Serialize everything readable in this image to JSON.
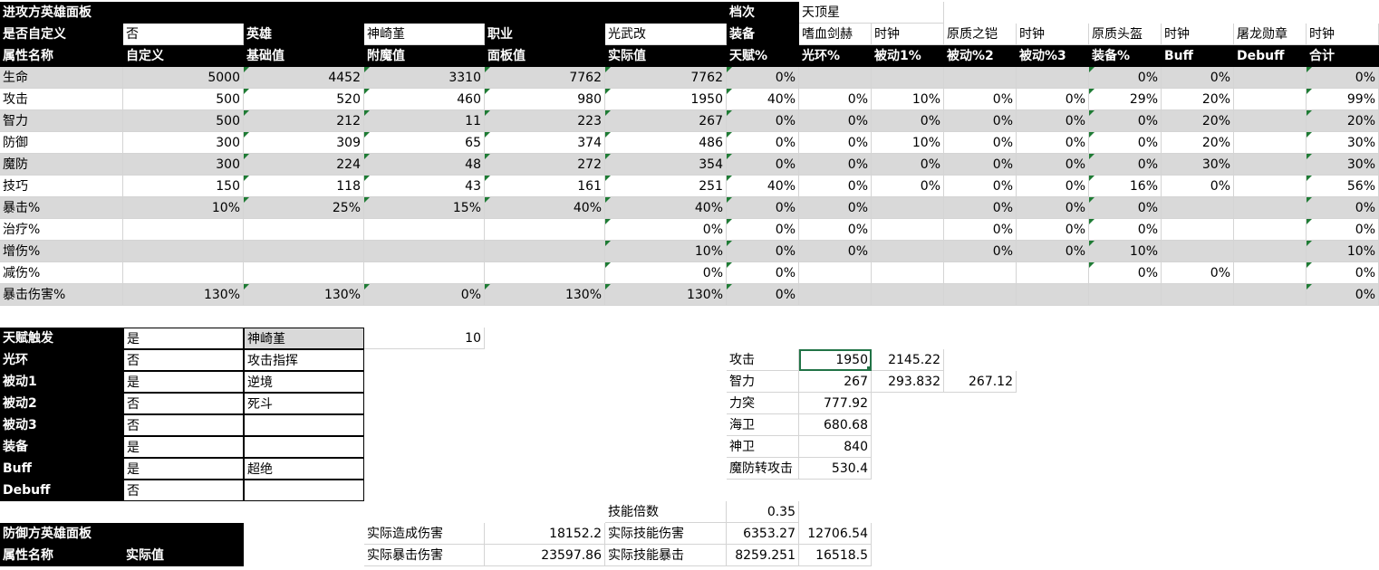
{
  "attacker": {
    "title": "进攻方英雄面板",
    "level_label": "档次",
    "level_value": "天顶星",
    "custom_label": "是否自定义",
    "custom_value": "否",
    "hero_label": "英雄",
    "hero_value": "神崎堇",
    "class_label": "职业",
    "class_value": "光武改",
    "equip_label": "装备",
    "equip_slots": [
      {
        "name": "嗜血剑赫",
        "suffix": "时钟"
      },
      {
        "name": "原质之铠",
        "suffix": "时钟"
      },
      {
        "name": "原质头盔",
        "suffix": "时钟"
      },
      {
        "name": "屠龙勋章",
        "suffix": "时钟"
      }
    ],
    "headers": [
      "属性名称",
      "自定义",
      "基础值",
      "附魔值",
      "面板值",
      "实际值",
      "天赋%",
      "光环%",
      "被动1%",
      "被动%2",
      "被动%3",
      "装备%",
      "Buff",
      "Debuff",
      "合计"
    ],
    "rows": [
      [
        "生命",
        "5000",
        "4452",
        "3310",
        "7762",
        "7762",
        "0%",
        "",
        "",
        "",
        "",
        "0%",
        "0%",
        "",
        "0%"
      ],
      [
        "攻击",
        "500",
        "520",
        "460",
        "980",
        "1950",
        "40%",
        "0%",
        "10%",
        "0%",
        "0%",
        "29%",
        "20%",
        "",
        "99%"
      ],
      [
        "智力",
        "500",
        "212",
        "11",
        "223",
        "267",
        "0%",
        "0%",
        "0%",
        "0%",
        "0%",
        "0%",
        "20%",
        "",
        "20%"
      ],
      [
        "防御",
        "300",
        "309",
        "65",
        "374",
        "486",
        "0%",
        "0%",
        "10%",
        "0%",
        "0%",
        "0%",
        "20%",
        "",
        "30%"
      ],
      [
        "魔防",
        "300",
        "224",
        "48",
        "272",
        "354",
        "0%",
        "0%",
        "0%",
        "0%",
        "0%",
        "0%",
        "30%",
        "",
        "30%"
      ],
      [
        "技巧",
        "150",
        "118",
        "43",
        "161",
        "251",
        "40%",
        "0%",
        "0%",
        "0%",
        "0%",
        "16%",
        "0%",
        "",
        "56%"
      ],
      [
        "暴击%",
        "10%",
        "25%",
        "15%",
        "40%",
        "40%",
        "0%",
        "0%",
        "",
        "0%",
        "0%",
        "0%",
        "",
        "",
        "0%"
      ],
      [
        "治疗%",
        "",
        "",
        "",
        "",
        "0%",
        "0%",
        "0%",
        "",
        "0%",
        "0%",
        "0%",
        "",
        "",
        "0%"
      ],
      [
        "增伤%",
        "",
        "",
        "",
        "",
        "10%",
        "0%",
        "0%",
        "",
        "0%",
        "0%",
        "10%",
        "",
        "",
        "10%"
      ],
      [
        "减伤%",
        "",
        "",
        "",
        "",
        "0%",
        "0%",
        "",
        "",
        "",
        "",
        "0%",
        "0%",
        "",
        "0%"
      ],
      [
        "暴击伤害%",
        "130%",
        "130%",
        "0%",
        "130%",
        "130%",
        "0%",
        "",
        "",
        "",
        "",
        "",
        "",
        "",
        "0%"
      ]
    ]
  },
  "toggles": {
    "rows": [
      {
        "label": "天赋触发",
        "value": "是",
        "name": "神崎堇",
        "extra": "10"
      },
      {
        "label": "光环",
        "value": "否",
        "name": "攻击指挥"
      },
      {
        "label": "被动1",
        "value": "是",
        "name": "逆境"
      },
      {
        "label": "被动2",
        "value": "否",
        "name": "死斗"
      },
      {
        "label": "被动3",
        "value": "否",
        "name": ""
      },
      {
        "label": "装备",
        "value": "是",
        "name": ""
      },
      {
        "label": "Buff",
        "value": "是",
        "name": "超绝"
      },
      {
        "label": "Debuff",
        "value": "否",
        "name": ""
      }
    ]
  },
  "calc": {
    "rows": [
      {
        "label": "攻击",
        "v1": "1950",
        "v2": "2145.22",
        "v3": ""
      },
      {
        "label": "智力",
        "v1": "267",
        "v2": "293.832",
        "v3": "267.12"
      },
      {
        "label": "力突",
        "v1": "777.92",
        "v2": "",
        "v3": ""
      },
      {
        "label": "海卫",
        "v1": "680.68",
        "v2": "",
        "v3": ""
      },
      {
        "label": "神卫",
        "v1": "840",
        "v2": "",
        "v3": ""
      },
      {
        "label": "魔防转攻击",
        "v1": "530.4",
        "v2": "",
        "v3": ""
      }
    ]
  },
  "damage": {
    "skill_mult_label": "技能倍数",
    "skill_mult_value": "0.35",
    "actual_dmg_label": "实际造成伤害",
    "actual_dmg_value": "18152.2",
    "actual_crit_label": "实际暴击伤害",
    "actual_crit_value": "23597.86",
    "skill_dmg_label": "实际技能伤害",
    "skill_dmg_v1": "6353.27",
    "skill_dmg_v2": "12706.54",
    "skill_crit_label": "实际技能暴击",
    "skill_crit_v1": "8259.251",
    "skill_crit_v2": "16518.5"
  },
  "defender": {
    "title": "防御方英雄面板",
    "attr_label": "属性名称",
    "actual_label": "实际值"
  }
}
